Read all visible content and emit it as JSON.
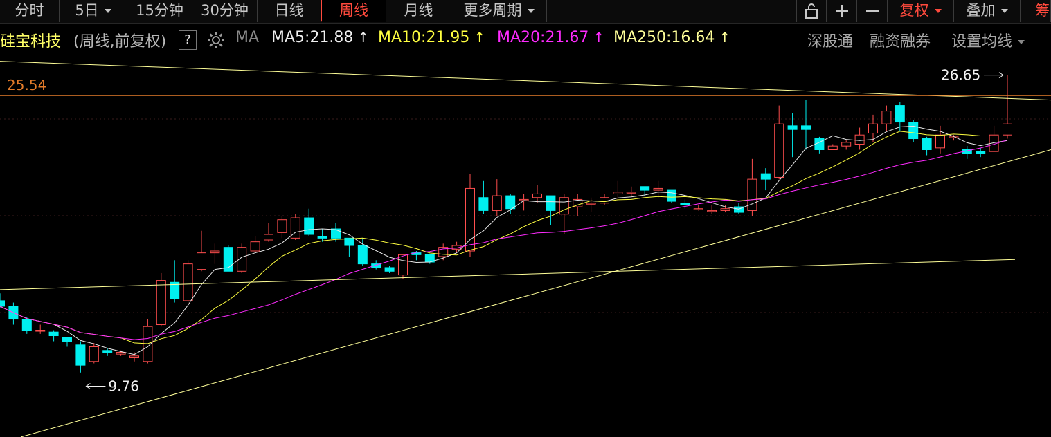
{
  "toolbar": {
    "tabs": [
      {
        "label": "分时"
      },
      {
        "label": "5日"
      },
      {
        "label": "15分钟"
      },
      {
        "label": "30分钟"
      },
      {
        "label": "日线"
      },
      {
        "label": "周线"
      },
      {
        "label": "月线"
      },
      {
        "label": "更多周期"
      }
    ],
    "active_tab": "周线",
    "icon_buttons": [
      "lock-icon",
      "zoom-in-icon",
      "zoom-out-icon"
    ],
    "fuquan_label": "复权",
    "overlay_label": "叠加",
    "chip_label": "筹"
  },
  "info": {
    "stock_name": "硅宝科技",
    "period_text": "(周线,前复权)",
    "help_label": "?",
    "ma_label": "MA",
    "ma5": "MA5:21.88",
    "ma10": "MA10:21.95",
    "ma20": "MA20:21.67",
    "ma250": "MA250:16.64",
    "links": [
      "深股通",
      "融资融券",
      "设置均线"
    ]
  },
  "colors": {
    "up": "#ff4e4e",
    "down": "#00f0f0",
    "ma5": "#e8e8e8",
    "ma10": "#ffff40",
    "ma20": "#ff2bff",
    "ma250": "#ffff99",
    "price_line": "#e47c2a"
  },
  "chart_data": {
    "type": "candlestick",
    "price_line_label": "25.54",
    "price_line_value": 25.54,
    "high_annotation": "26.65",
    "high_value": 26.65,
    "low_annotation": "9.76",
    "low_value": 9.76,
    "y_range": [
      7.0,
      27.8
    ],
    "candles": [
      [
        14.4,
        14.1,
        14.8,
        14.0
      ],
      [
        14.1,
        13.4,
        14.3,
        13.1
      ],
      [
        13.4,
        12.8,
        13.5,
        12.6
      ],
      [
        12.8,
        12.8,
        13.1,
        12.6
      ],
      [
        12.7,
        12.5,
        12.8,
        12.2
      ],
      [
        12.4,
        12.2,
        12.4,
        11.9
      ],
      [
        12.0,
        10.9,
        12.2,
        10.5
      ],
      [
        11.1,
        11.9,
        12.1,
        11.0
      ],
      [
        11.7,
        11.6,
        11.8,
        11.4
      ],
      [
        11.5,
        11.6,
        11.7,
        11.4
      ],
      [
        11.3,
        11.4,
        11.6,
        11.1
      ],
      [
        11.1,
        13.0,
        13.4,
        11.0
      ],
      [
        13.1,
        15.5,
        15.9,
        13.0
      ],
      [
        15.4,
        14.5,
        16.6,
        14.3
      ],
      [
        14.4,
        16.4,
        16.6,
        14.2
      ],
      [
        16.1,
        17.0,
        18.2,
        16.0
      ],
      [
        17.0,
        17.1,
        17.5,
        16.4
      ],
      [
        17.3,
        16.0,
        17.4,
        16.0
      ],
      [
        16.0,
        17.3,
        17.5,
        15.9
      ],
      [
        17.1,
        17.6,
        17.9,
        17.0
      ],
      [
        17.7,
        18.0,
        18.6,
        17.6
      ],
      [
        18.1,
        18.8,
        19.0,
        17.8
      ],
      [
        17.8,
        18.9,
        19.1,
        17.7
      ],
      [
        18.9,
        18.0,
        19.4,
        17.9
      ],
      [
        17.9,
        17.8,
        18.3,
        17.6
      ],
      [
        18.3,
        17.8,
        18.6,
        17.6
      ],
      [
        17.8,
        17.4,
        17.8,
        16.8
      ],
      [
        17.4,
        16.4,
        17.8,
        16.3
      ],
      [
        16.4,
        16.2,
        16.6,
        16.1
      ],
      [
        16.2,
        16.0,
        16.3,
        15.9
      ],
      [
        15.8,
        16.9,
        16.9,
        15.6
      ],
      [
        17.0,
        16.9,
        17.1,
        16.6
      ],
      [
        16.9,
        16.5,
        16.9,
        16.4
      ],
      [
        16.8,
        17.3,
        17.5,
        16.6
      ],
      [
        17.2,
        17.4,
        17.6,
        17.0
      ],
      [
        17.1,
        20.5,
        21.3,
        16.8
      ],
      [
        20.0,
        19.3,
        20.9,
        19.1
      ],
      [
        19.3,
        20.1,
        21.0,
        19.0
      ],
      [
        20.1,
        19.4,
        20.2,
        19.1
      ],
      [
        19.9,
        19.9,
        20.2,
        19.3
      ],
      [
        20.0,
        20.2,
        20.7,
        19.7
      ],
      [
        20.1,
        19.3,
        20.1,
        18.5
      ],
      [
        19.1,
        20.0,
        20.2,
        18.0
      ],
      [
        19.5,
        19.9,
        20.2,
        19.0
      ],
      [
        19.7,
        19.7,
        20.0,
        19.2
      ],
      [
        19.7,
        20.0,
        20.2,
        19.6
      ],
      [
        20.2,
        20.3,
        20.9,
        19.9
      ],
      [
        20.3,
        20.3,
        20.6,
        20.1
      ],
      [
        20.6,
        20.4,
        20.6,
        20.1
      ],
      [
        20.4,
        20.5,
        20.9,
        20.0
      ],
      [
        20.4,
        19.8,
        20.4,
        19.7
      ],
      [
        19.7,
        19.6,
        19.9,
        19.4
      ],
      [
        19.4,
        19.4,
        19.6,
        19.3
      ],
      [
        19.3,
        19.3,
        19.6,
        19.1
      ],
      [
        19.3,
        19.4,
        19.6,
        19.2
      ],
      [
        19.5,
        19.2,
        19.7,
        19.1
      ],
      [
        19.3,
        21.0,
        22.1,
        19.0
      ],
      [
        21.3,
        21.0,
        21.6,
        20.4
      ],
      [
        21.1,
        24.0,
        25.0,
        21.0
      ],
      [
        23.9,
        23.7,
        24.6,
        22.2
      ],
      [
        23.9,
        23.7,
        25.3,
        22.6
      ],
      [
        23.2,
        22.6,
        23.3,
        22.4
      ],
      [
        22.6,
        22.8,
        22.9,
        22.6
      ],
      [
        22.8,
        23.0,
        23.1,
        22.6
      ],
      [
        22.9,
        23.4,
        23.8,
        22.6
      ],
      [
        23.5,
        24.0,
        24.5,
        23.0
      ],
      [
        24.0,
        24.7,
        25.0,
        23.6
      ],
      [
        25.0,
        24.1,
        25.2,
        23.6
      ],
      [
        24.1,
        23.2,
        24.2,
        23.0
      ],
      [
        23.2,
        22.6,
        23.3,
        22.3
      ],
      [
        22.7,
        23.4,
        23.9,
        22.4
      ],
      [
        23.3,
        23.3,
        23.4,
        23.1
      ],
      [
        22.6,
        22.4,
        22.8,
        22.1
      ],
      [
        22.5,
        22.4,
        22.7,
        22.2
      ],
      [
        22.5,
        23.4,
        23.9,
        22.5
      ],
      [
        23.4,
        24.0,
        26.65,
        23.2
      ]
    ]
  }
}
